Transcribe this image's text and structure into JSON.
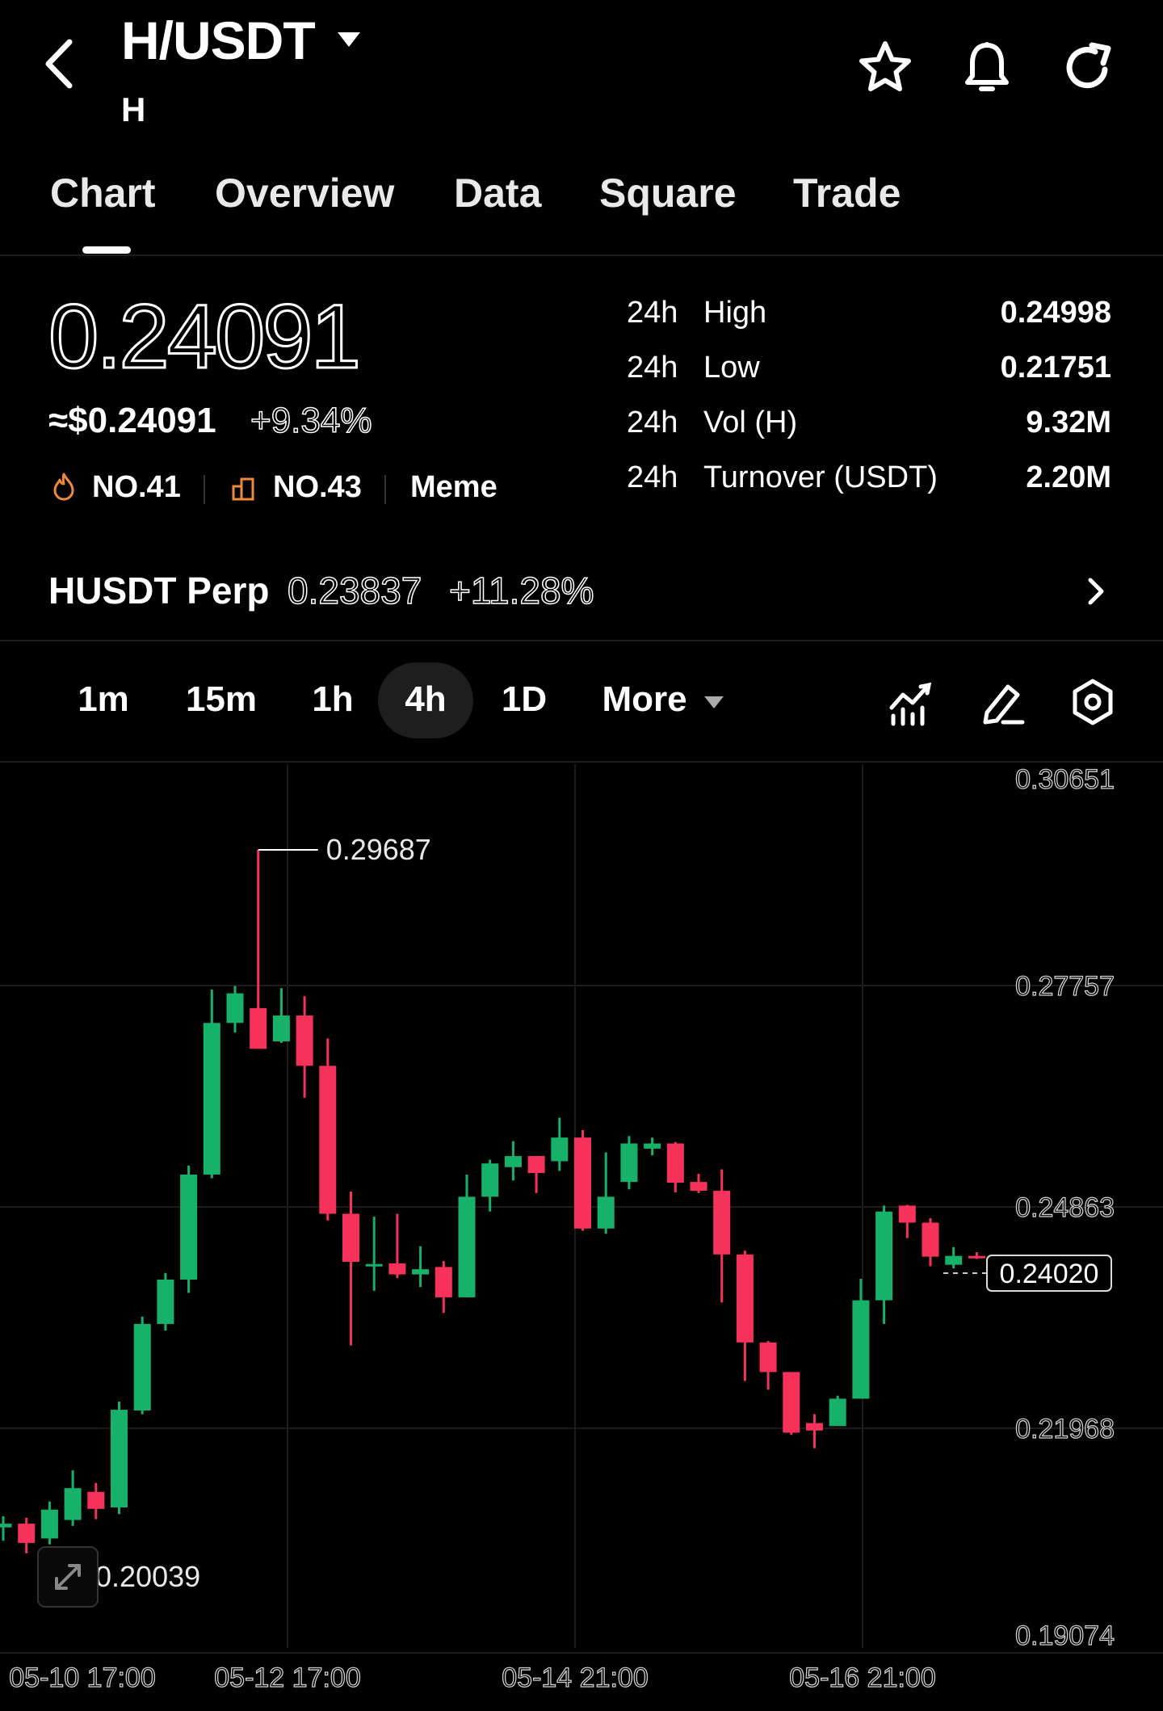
{
  "header": {
    "pair": "H/USDT",
    "base": "H"
  },
  "tabs": [
    "Chart",
    "Overview",
    "Data",
    "Square",
    "Trade"
  ],
  "active_tab": "Chart",
  "price": {
    "last": "0.24091",
    "usd": "≈$0.24091",
    "change": "+9.34%"
  },
  "ranks": {
    "rank1": "NO.41",
    "rank2": "NO.43",
    "tag": "Meme"
  },
  "stats": [
    {
      "period": "24h",
      "label": "High",
      "value": "0.24998"
    },
    {
      "period": "24h",
      "label": "Low",
      "value": "0.21751"
    },
    {
      "period": "24h",
      "label": "Vol (H)",
      "value": "9.32M"
    },
    {
      "period": "24h",
      "label": "Turnover (USDT)",
      "value": "2.20M"
    }
  ],
  "perp": {
    "name": "HUSDT Perp",
    "price": "0.23837",
    "change": "+11.28%"
  },
  "intervals": [
    "1m",
    "15m",
    "1h",
    "4h",
    "1D",
    "More"
  ],
  "active_interval": "4h",
  "colors": {
    "up": "#17b26a",
    "down": "#f6325a",
    "bg": "#000000"
  },
  "chart_data": {
    "type": "candlestick",
    "title": "",
    "y_ticks": [
      "0.30651",
      "0.27757",
      "0.24863",
      "0.21968",
      "0.19074"
    ],
    "x_ticks": [
      "05-10 17:00",
      "05-12 17:00",
      "05-14 21:00",
      "05-16 21:00"
    ],
    "ylim": [
      0.19074,
      0.30651
    ],
    "max_label": "0.29687",
    "min_label": "0.20039",
    "current_price_label": "0.24020",
    "grid": true,
    "candles": [
      {
        "o": 0.2053,
        "h": 0.2068,
        "l": 0.2035,
        "c": 0.2058
      },
      {
        "o": 0.2058,
        "h": 0.2066,
        "l": 0.2018,
        "c": 0.2032
      },
      {
        "o": 0.2038,
        "h": 0.2088,
        "l": 0.203,
        "c": 0.2077
      },
      {
        "o": 0.2063,
        "h": 0.213,
        "l": 0.2055,
        "c": 0.2106
      },
      {
        "o": 0.2101,
        "h": 0.2113,
        "l": 0.2064,
        "c": 0.2078
      },
      {
        "o": 0.208,
        "h": 0.2223,
        "l": 0.2071,
        "c": 0.2212
      },
      {
        "o": 0.2211,
        "h": 0.2338,
        "l": 0.2206,
        "c": 0.2328
      },
      {
        "o": 0.2328,
        "h": 0.2397,
        "l": 0.2319,
        "c": 0.2388
      },
      {
        "o": 0.2388,
        "h": 0.2542,
        "l": 0.237,
        "c": 0.253
      },
      {
        "o": 0.253,
        "h": 0.278,
        "l": 0.2525,
        "c": 0.2735
      },
      {
        "o": 0.2735,
        "h": 0.2785,
        "l": 0.2722,
        "c": 0.2775
      },
      {
        "o": 0.2755,
        "h": 0.2969,
        "l": 0.2721,
        "c": 0.27
      },
      {
        "o": 0.271,
        "h": 0.2782,
        "l": 0.2708,
        "c": 0.2745
      },
      {
        "o": 0.2745,
        "h": 0.2771,
        "l": 0.2634,
        "c": 0.2677
      },
      {
        "o": 0.2677,
        "h": 0.2714,
        "l": 0.2468,
        "c": 0.2477
      },
      {
        "o": 0.2477,
        "h": 0.2507,
        "l": 0.2299,
        "c": 0.2412
      },
      {
        "o": 0.2409,
        "h": 0.2473,
        "l": 0.2373,
        "c": 0.2409
      },
      {
        "o": 0.241,
        "h": 0.2477,
        "l": 0.239,
        "c": 0.2395
      },
      {
        "o": 0.2395,
        "h": 0.2433,
        "l": 0.2378,
        "c": 0.2402
      },
      {
        "o": 0.2405,
        "h": 0.2413,
        "l": 0.2343,
        "c": 0.2364
      },
      {
        "o": 0.2364,
        "h": 0.253,
        "l": 0.2364,
        "c": 0.25
      },
      {
        "o": 0.25,
        "h": 0.255,
        "l": 0.248,
        "c": 0.2545
      },
      {
        "o": 0.254,
        "h": 0.2575,
        "l": 0.2522,
        "c": 0.2555
      },
      {
        "o": 0.2555,
        "h": 0.2555,
        "l": 0.2505,
        "c": 0.2532
      },
      {
        "o": 0.2548,
        "h": 0.2607,
        "l": 0.2535,
        "c": 0.258
      },
      {
        "o": 0.258,
        "h": 0.259,
        "l": 0.2454,
        "c": 0.2457
      },
      {
        "o": 0.2457,
        "h": 0.256,
        "l": 0.245,
        "c": 0.25
      },
      {
        "o": 0.252,
        "h": 0.2582,
        "l": 0.251,
        "c": 0.2572
      },
      {
        "o": 0.2565,
        "h": 0.258,
        "l": 0.2556,
        "c": 0.2572
      },
      {
        "o": 0.2572,
        "h": 0.2574,
        "l": 0.2506,
        "c": 0.2519
      },
      {
        "o": 0.252,
        "h": 0.2531,
        "l": 0.2505,
        "c": 0.2508
      },
      {
        "o": 0.2508,
        "h": 0.2537,
        "l": 0.2357,
        "c": 0.2422
      },
      {
        "o": 0.2422,
        "h": 0.2427,
        "l": 0.2251,
        "c": 0.2303
      },
      {
        "o": 0.2303,
        "h": 0.2305,
        "l": 0.2239,
        "c": 0.2263
      },
      {
        "o": 0.2263,
        "h": 0.2247,
        "l": 0.2178,
        "c": 0.2181
      },
      {
        "o": 0.2194,
        "h": 0.2206,
        "l": 0.216,
        "c": 0.2184
      },
      {
        "o": 0.219,
        "h": 0.2231,
        "l": 0.219,
        "c": 0.2227
      },
      {
        "o": 0.2227,
        "h": 0.2389,
        "l": 0.2227,
        "c": 0.236
      },
      {
        "o": 0.236,
        "h": 0.2488,
        "l": 0.2328,
        "c": 0.248
      },
      {
        "o": 0.2488,
        "h": 0.2489,
        "l": 0.2444,
        "c": 0.2465
      },
      {
        "o": 0.2465,
        "h": 0.2471,
        "l": 0.2406,
        "c": 0.2419
      },
      {
        "o": 0.2408,
        "h": 0.2432,
        "l": 0.2403,
        "c": 0.242
      },
      {
        "o": 0.242,
        "h": 0.2425,
        "l": 0.2416,
        "c": 0.2418
      }
    ]
  }
}
